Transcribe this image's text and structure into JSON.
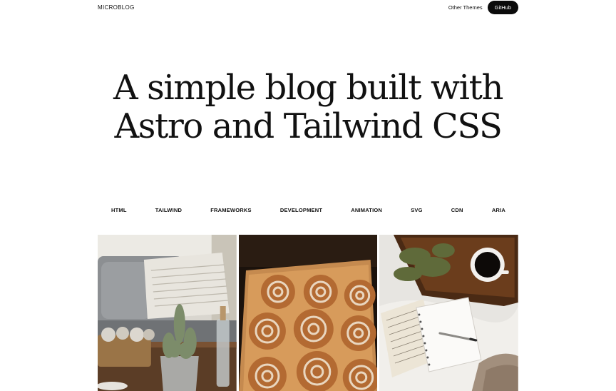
{
  "header": {
    "brand": "MICROBLOG",
    "other_themes": "Other Themes",
    "github": "GitHub"
  },
  "hero": {
    "line1": "A simple blog built with",
    "line2": "Astro and Tailwind CSS"
  },
  "tags": [
    "HTML",
    "TAILWIND",
    "FRAMEWORKS",
    "DEVELOPMENT",
    "ANIMATION",
    "SVG",
    "CDN",
    "ARIA"
  ],
  "gallery": [
    {
      "icon": "living-room-photo"
    },
    {
      "icon": "cinnamon-rolls-photo"
    },
    {
      "icon": "notebook-coffee-photo"
    }
  ]
}
